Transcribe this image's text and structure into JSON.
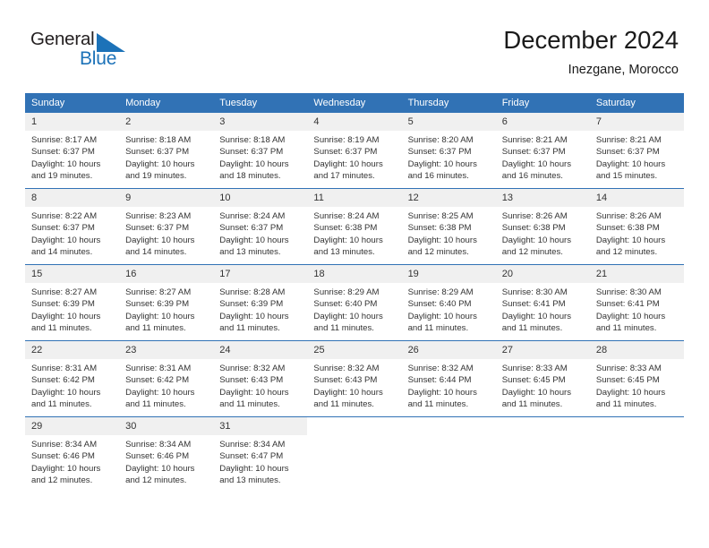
{
  "logo": {
    "word1": "General",
    "word2": "Blue",
    "triangle_icon": "triangle-icon",
    "brand_color": "#1c72b8",
    "text_color": "#231f20"
  },
  "header": {
    "title": "December 2024",
    "subtitle": "Inezgane, Morocco"
  },
  "theme": {
    "header_blue": "#3172b5",
    "daynum_band": "#f0f0f0",
    "text": "#333333"
  },
  "weekday_headers": [
    "Sunday",
    "Monday",
    "Tuesday",
    "Wednesday",
    "Thursday",
    "Friday",
    "Saturday"
  ],
  "weeks": [
    {
      "days": [
        {
          "day": "1",
          "sunrise": "Sunrise: 8:17 AM",
          "sunset": "Sunset: 6:37 PM",
          "daylight1": "Daylight: 10 hours",
          "daylight2": "and 19 minutes."
        },
        {
          "day": "2",
          "sunrise": "Sunrise: 8:18 AM",
          "sunset": "Sunset: 6:37 PM",
          "daylight1": "Daylight: 10 hours",
          "daylight2": "and 19 minutes."
        },
        {
          "day": "3",
          "sunrise": "Sunrise: 8:18 AM",
          "sunset": "Sunset: 6:37 PM",
          "daylight1": "Daylight: 10 hours",
          "daylight2": "and 18 minutes."
        },
        {
          "day": "4",
          "sunrise": "Sunrise: 8:19 AM",
          "sunset": "Sunset: 6:37 PM",
          "daylight1": "Daylight: 10 hours",
          "daylight2": "and 17 minutes."
        },
        {
          "day": "5",
          "sunrise": "Sunrise: 8:20 AM",
          "sunset": "Sunset: 6:37 PM",
          "daylight1": "Daylight: 10 hours",
          "daylight2": "and 16 minutes."
        },
        {
          "day": "6",
          "sunrise": "Sunrise: 8:21 AM",
          "sunset": "Sunset: 6:37 PM",
          "daylight1": "Daylight: 10 hours",
          "daylight2": "and 16 minutes."
        },
        {
          "day": "7",
          "sunrise": "Sunrise: 8:21 AM",
          "sunset": "Sunset: 6:37 PM",
          "daylight1": "Daylight: 10 hours",
          "daylight2": "and 15 minutes."
        }
      ]
    },
    {
      "days": [
        {
          "day": "8",
          "sunrise": "Sunrise: 8:22 AM",
          "sunset": "Sunset: 6:37 PM",
          "daylight1": "Daylight: 10 hours",
          "daylight2": "and 14 minutes."
        },
        {
          "day": "9",
          "sunrise": "Sunrise: 8:23 AM",
          "sunset": "Sunset: 6:37 PM",
          "daylight1": "Daylight: 10 hours",
          "daylight2": "and 14 minutes."
        },
        {
          "day": "10",
          "sunrise": "Sunrise: 8:24 AM",
          "sunset": "Sunset: 6:37 PM",
          "daylight1": "Daylight: 10 hours",
          "daylight2": "and 13 minutes."
        },
        {
          "day": "11",
          "sunrise": "Sunrise: 8:24 AM",
          "sunset": "Sunset: 6:38 PM",
          "daylight1": "Daylight: 10 hours",
          "daylight2": "and 13 minutes."
        },
        {
          "day": "12",
          "sunrise": "Sunrise: 8:25 AM",
          "sunset": "Sunset: 6:38 PM",
          "daylight1": "Daylight: 10 hours",
          "daylight2": "and 12 minutes."
        },
        {
          "day": "13",
          "sunrise": "Sunrise: 8:26 AM",
          "sunset": "Sunset: 6:38 PM",
          "daylight1": "Daylight: 10 hours",
          "daylight2": "and 12 minutes."
        },
        {
          "day": "14",
          "sunrise": "Sunrise: 8:26 AM",
          "sunset": "Sunset: 6:38 PM",
          "daylight1": "Daylight: 10 hours",
          "daylight2": "and 12 minutes."
        }
      ]
    },
    {
      "days": [
        {
          "day": "15",
          "sunrise": "Sunrise: 8:27 AM",
          "sunset": "Sunset: 6:39 PM",
          "daylight1": "Daylight: 10 hours",
          "daylight2": "and 11 minutes."
        },
        {
          "day": "16",
          "sunrise": "Sunrise: 8:27 AM",
          "sunset": "Sunset: 6:39 PM",
          "daylight1": "Daylight: 10 hours",
          "daylight2": "and 11 minutes."
        },
        {
          "day": "17",
          "sunrise": "Sunrise: 8:28 AM",
          "sunset": "Sunset: 6:39 PM",
          "daylight1": "Daylight: 10 hours",
          "daylight2": "and 11 minutes."
        },
        {
          "day": "18",
          "sunrise": "Sunrise: 8:29 AM",
          "sunset": "Sunset: 6:40 PM",
          "daylight1": "Daylight: 10 hours",
          "daylight2": "and 11 minutes."
        },
        {
          "day": "19",
          "sunrise": "Sunrise: 8:29 AM",
          "sunset": "Sunset: 6:40 PM",
          "daylight1": "Daylight: 10 hours",
          "daylight2": "and 11 minutes."
        },
        {
          "day": "20",
          "sunrise": "Sunrise: 8:30 AM",
          "sunset": "Sunset: 6:41 PM",
          "daylight1": "Daylight: 10 hours",
          "daylight2": "and 11 minutes."
        },
        {
          "day": "21",
          "sunrise": "Sunrise: 8:30 AM",
          "sunset": "Sunset: 6:41 PM",
          "daylight1": "Daylight: 10 hours",
          "daylight2": "and 11 minutes."
        }
      ]
    },
    {
      "days": [
        {
          "day": "22",
          "sunrise": "Sunrise: 8:31 AM",
          "sunset": "Sunset: 6:42 PM",
          "daylight1": "Daylight: 10 hours",
          "daylight2": "and 11 minutes."
        },
        {
          "day": "23",
          "sunrise": "Sunrise: 8:31 AM",
          "sunset": "Sunset: 6:42 PM",
          "daylight1": "Daylight: 10 hours",
          "daylight2": "and 11 minutes."
        },
        {
          "day": "24",
          "sunrise": "Sunrise: 8:32 AM",
          "sunset": "Sunset: 6:43 PM",
          "daylight1": "Daylight: 10 hours",
          "daylight2": "and 11 minutes."
        },
        {
          "day": "25",
          "sunrise": "Sunrise: 8:32 AM",
          "sunset": "Sunset: 6:43 PM",
          "daylight1": "Daylight: 10 hours",
          "daylight2": "and 11 minutes."
        },
        {
          "day": "26",
          "sunrise": "Sunrise: 8:32 AM",
          "sunset": "Sunset: 6:44 PM",
          "daylight1": "Daylight: 10 hours",
          "daylight2": "and 11 minutes."
        },
        {
          "day": "27",
          "sunrise": "Sunrise: 8:33 AM",
          "sunset": "Sunset: 6:45 PM",
          "daylight1": "Daylight: 10 hours",
          "daylight2": "and 11 minutes."
        },
        {
          "day": "28",
          "sunrise": "Sunrise: 8:33 AM",
          "sunset": "Sunset: 6:45 PM",
          "daylight1": "Daylight: 10 hours",
          "daylight2": "and 11 minutes."
        }
      ]
    },
    {
      "days": [
        {
          "day": "29",
          "sunrise": "Sunrise: 8:34 AM",
          "sunset": "Sunset: 6:46 PM",
          "daylight1": "Daylight: 10 hours",
          "daylight2": "and 12 minutes."
        },
        {
          "day": "30",
          "sunrise": "Sunrise: 8:34 AM",
          "sunset": "Sunset: 6:46 PM",
          "daylight1": "Daylight: 10 hours",
          "daylight2": "and 12 minutes."
        },
        {
          "day": "31",
          "sunrise": "Sunrise: 8:34 AM",
          "sunset": "Sunset: 6:47 PM",
          "daylight1": "Daylight: 10 hours",
          "daylight2": "and 13 minutes."
        },
        {
          "day": "",
          "sunrise": "",
          "sunset": "",
          "daylight1": "",
          "daylight2": "",
          "blank": true
        },
        {
          "day": "",
          "sunrise": "",
          "sunset": "",
          "daylight1": "",
          "daylight2": "",
          "blank": true
        },
        {
          "day": "",
          "sunrise": "",
          "sunset": "",
          "daylight1": "",
          "daylight2": "",
          "blank": true
        },
        {
          "day": "",
          "sunrise": "",
          "sunset": "",
          "daylight1": "",
          "daylight2": "",
          "blank": true
        }
      ]
    }
  ]
}
